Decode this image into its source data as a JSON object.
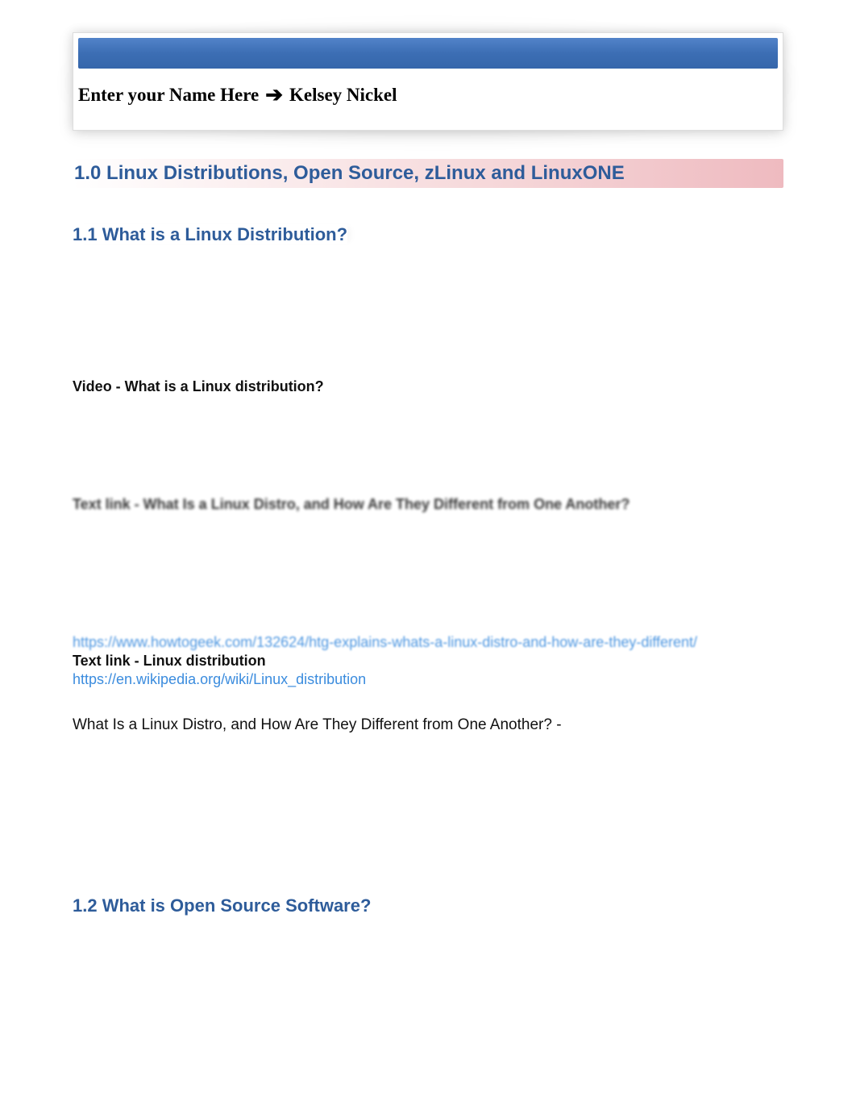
{
  "header": {
    "prompt": "Enter your Name Here",
    "arrow": "➔",
    "name": "Kelsey Nickel"
  },
  "sections": {
    "s1_0": "1.0 Linux Distributions, Open Source, zLinux and LinuxONE",
    "s1_1": "1.1 What is a Linux Distribution?",
    "s1_2": "1.2 What is Open Source Software?"
  },
  "labels": {
    "video": "Video - What is a Linux distribution?",
    "textlink1": "Text link - What Is a Linux Distro, and How Are They Different from One Another?",
    "textlink2": "Text link - Linux distribution"
  },
  "links": {
    "howtogeek": "https://www.howtogeek.com/132624/htg-explains-whats-a-linux-distro-and-how-are-they-different/",
    "wikipedia": "https://en.wikipedia.org/wiki/Linux_distribution"
  },
  "body": {
    "q1": "What Is a Linux Distro, and How Are They Different from One Another? -"
  }
}
